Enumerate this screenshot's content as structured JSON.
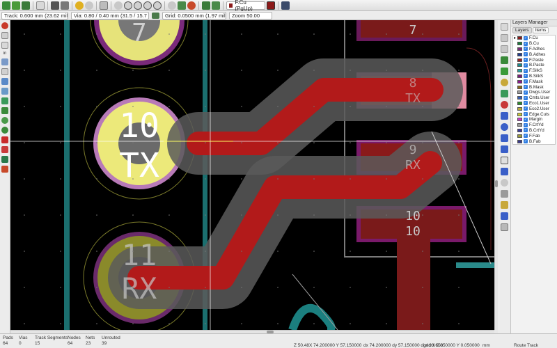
{
  "toolbar": {
    "active_layer": "F.Cu (PgUp)",
    "icons": [
      "new-board-icon",
      "open-board-icon",
      "save-icon",
      "page-settings-icon",
      "plot-icon",
      "print-icon",
      "undo-icon",
      "redo-icon",
      "find-icon",
      "refresh-icon",
      "zoom-in-icon",
      "zoom-out-icon",
      "zoom-fit-icon",
      "zoom-area-icon",
      "rotate-icon",
      "netlist-icon",
      "drc-icon",
      "footprint-editor-icon",
      "footprint-browser-icon",
      "layer-pair-icon",
      "python-console-icon"
    ]
  },
  "options": {
    "track": "Track: 0.600 mm (23.62 mils)",
    "via": "Via: 0.80 / 0.40 mm (31.5 / 15.7 mils)",
    "grid": "Grid: 0.0500 mm (1.97 mils)",
    "zoom": "Zoom 50.00"
  },
  "left_toolbar": {
    "units_label": "in"
  },
  "board": {
    "pad_labels": [
      {
        "num": "7",
        "name": ""
      },
      {
        "num": "10",
        "name": "TX"
      },
      {
        "num": "11",
        "name": "RX"
      }
    ],
    "smd_labels": [
      {
        "num": "7",
        "name": ""
      },
      {
        "num": "8",
        "name": "TX"
      },
      {
        "num": "9",
        "name": "RX"
      },
      {
        "num": "10",
        "name": "10"
      }
    ]
  },
  "layers_manager": {
    "title": "Layers Manager",
    "tabs": [
      "Layers",
      "Items"
    ],
    "layers": [
      {
        "name": "F.Cu",
        "color": "#8b1a1a",
        "active": true
      },
      {
        "name": "B.Cu",
        "color": "#1b7a3a",
        "active": false
      },
      {
        "name": "F.Adhes",
        "color": "#7a2c7a",
        "active": false
      },
      {
        "name": "B.Adhes",
        "color": "#1f3b8b",
        "active": false
      },
      {
        "name": "F.Paste",
        "color": "#9a2222",
        "active": false
      },
      {
        "name": "B.Paste",
        "color": "#1a8a8a",
        "active": false
      },
      {
        "name": "F.SilkS",
        "color": "#2aa0a0",
        "active": false
      },
      {
        "name": "B.SilkS",
        "color": "#7a1f7a",
        "active": false
      },
      {
        "name": "F.Mask",
        "color": "#8a1a8a",
        "active": false
      },
      {
        "name": "B.Mask",
        "color": "#8a6a1a",
        "active": false
      },
      {
        "name": "Dwgs.User",
        "color": "#9a9a9a",
        "active": false
      },
      {
        "name": "Cmts.User",
        "color": "#3a5fb0",
        "active": false
      },
      {
        "name": "Eco1.User",
        "color": "#2a8a2a",
        "active": false
      },
      {
        "name": "Eco2.User",
        "color": "#b8a83a",
        "active": false
      },
      {
        "name": "Edge.Cuts",
        "color": "#c8c83a",
        "active": false
      },
      {
        "name": "Margin",
        "color": "#c83ac8",
        "active": false
      },
      {
        "name": "F.CrtYd",
        "color": "#9a9a9a",
        "active": false
      },
      {
        "name": "B.CrtYd",
        "color": "#3a3a9a",
        "active": false
      },
      {
        "name": "F.Fab",
        "color": "#9a9a3a",
        "active": false
      },
      {
        "name": "B.Fab",
        "color": "#3a3a8a",
        "active": false
      }
    ]
  },
  "status": {
    "pads_label": "Pads",
    "pads_value": "64",
    "vias_label": "Vias",
    "vias_value": "0",
    "segments_label": "Track Segments",
    "segments_value": "15",
    "nodes_label": "Nodes",
    "nodes_value": "64",
    "nets_label": "Nets",
    "nets_value": "23",
    "unrouted_label": "Unrouted",
    "unrouted_value": "39",
    "z": "Z 50.48",
    "xy": "X 74.200000  Y 57.150000",
    "dxdy": "dx 74.200000  dy 57.150000  dist 93.658",
    "grid": "grid X 0.050000  Y 0.050000",
    "units": "mm",
    "mode": "Route Track"
  }
}
